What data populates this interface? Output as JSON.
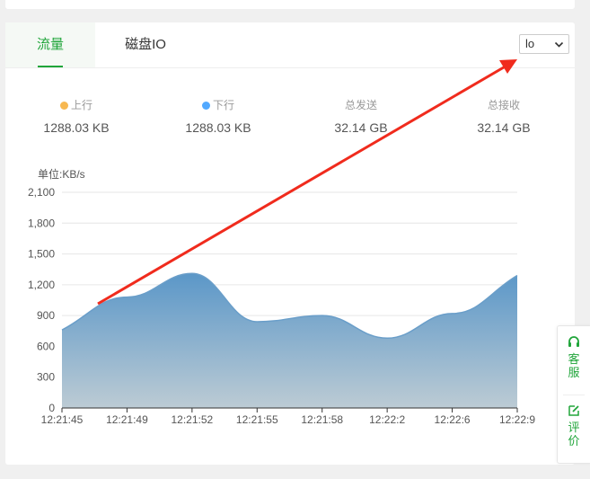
{
  "tabs": [
    {
      "label": "流量",
      "active": true
    },
    {
      "label": "磁盘IO",
      "active": false
    }
  ],
  "select": {
    "value": "lo"
  },
  "stats": [
    {
      "label": "上行",
      "value": "1288.03 KB",
      "dot_color": "#f7b851"
    },
    {
      "label": "下行",
      "value": "1288.03 KB",
      "dot_color": "#52a9ff"
    },
    {
      "label": "总发送",
      "value": "32.14 GB"
    },
    {
      "label": "总接收",
      "value": "32.14 GB"
    }
  ],
  "unit_label": "单位:KB/s",
  "side": {
    "service_label": "客服",
    "service_icon": "headset-icon",
    "review_label": "评价",
    "review_icon": "edit-icon"
  },
  "colors": {
    "accent": "#20a53a",
    "area_top": "#5b97c8",
    "area_bottom": "#bccbd4",
    "arrow": "#f02b1d"
  },
  "chart_data": {
    "type": "area",
    "unit": "KB/s",
    "x": [
      "12:21:45",
      "12:21:49",
      "12:21:52",
      "12:21:55",
      "12:21:58",
      "12:22:2",
      "12:22:6",
      "12:22:9"
    ],
    "series": [
      {
        "values": [
          760,
          1080,
          1310,
          840,
          900,
          680,
          920,
          1290
        ]
      }
    ],
    "y_ticks": [
      "0",
      "300",
      "600",
      "900",
      "1,200",
      "1,500",
      "1,800",
      "2,100"
    ],
    "ylim": [
      0,
      2100
    ],
    "grid": true
  }
}
